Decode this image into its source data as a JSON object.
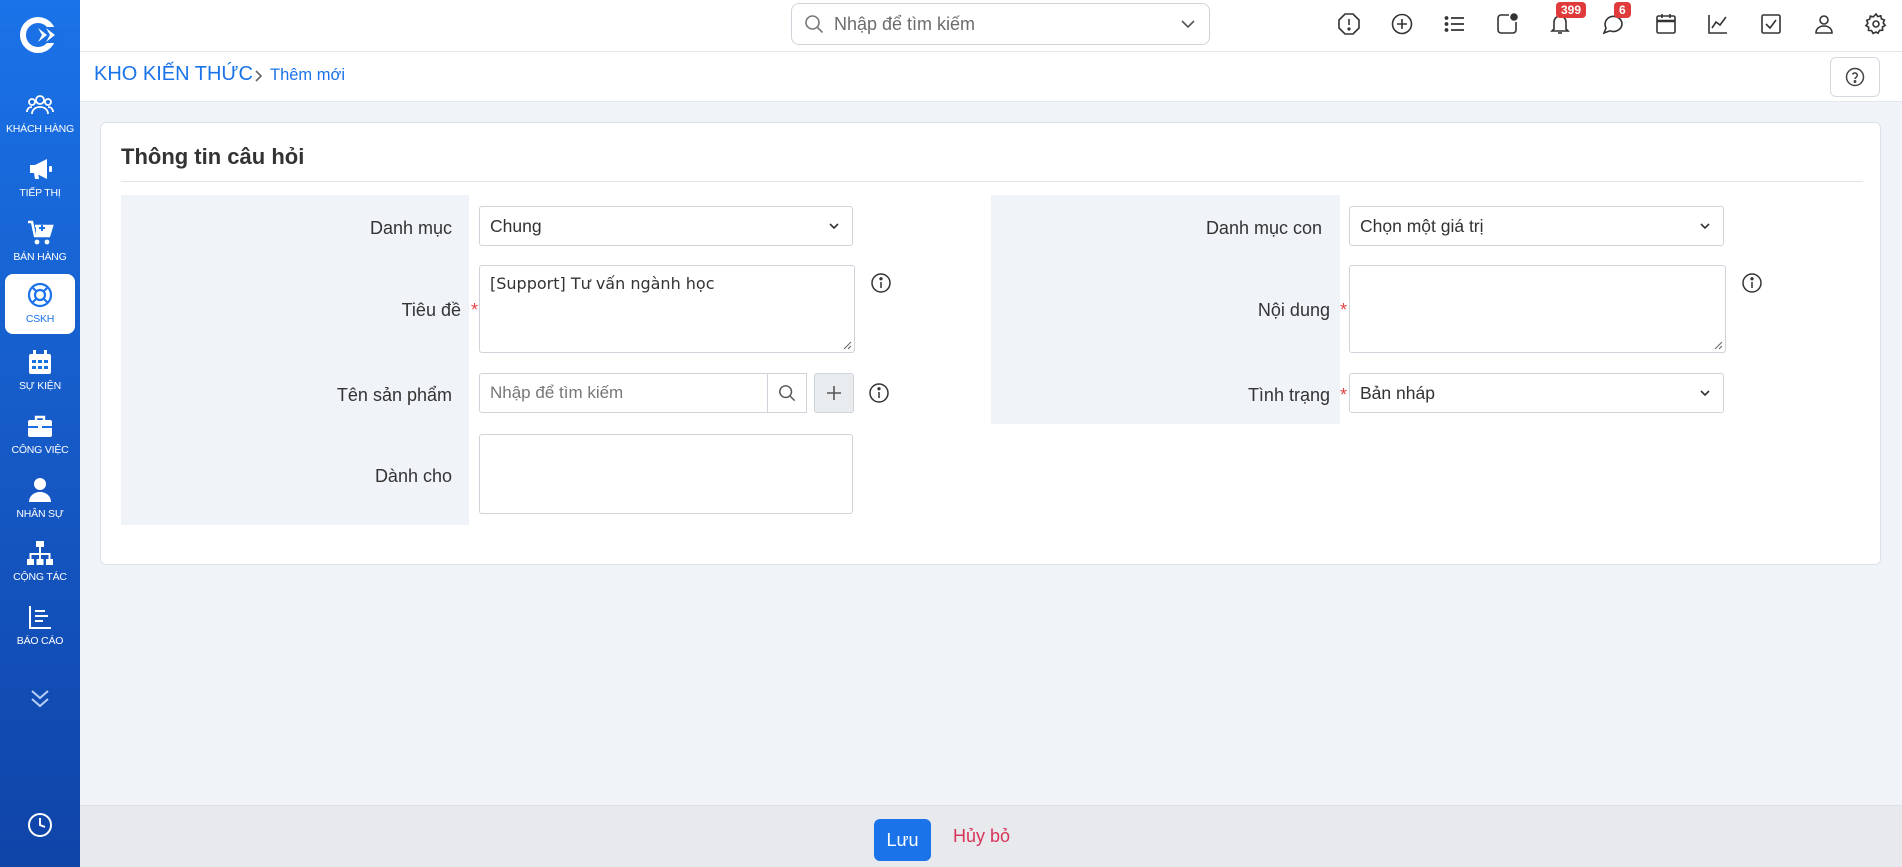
{
  "sidebar": {
    "items": [
      {
        "label": "KHÁCH HÀNG",
        "icon": "users-icon"
      },
      {
        "label": "TIẾP THỊ",
        "icon": "megaphone-icon"
      },
      {
        "label": "BÁN HÀNG",
        "icon": "cart-icon"
      },
      {
        "label": "CSKH",
        "icon": "lifebuoy-icon",
        "active": true
      },
      {
        "label": "SỰ KIỆN",
        "icon": "calendar-icon"
      },
      {
        "label": "CÔNG VIỆC",
        "icon": "briefcase-icon"
      },
      {
        "label": "NHÂN SỰ",
        "icon": "person-icon"
      },
      {
        "label": "CỘNG TÁC",
        "icon": "org-chart-icon"
      },
      {
        "label": "BÁO CÁO",
        "icon": "report-icon"
      }
    ]
  },
  "topbar": {
    "search_placeholder": "Nhập để tìm kiếm",
    "notifications_count": "399",
    "messages_count": "6"
  },
  "breadcrumb": {
    "root": "KHO KIẾN THỨC",
    "current": "Thêm mới"
  },
  "form": {
    "title": "Thông tin câu hỏi",
    "category_label": "Danh mục",
    "category_value": "Chung",
    "title_label": "Tiêu đề",
    "title_value": "[Support] Tư vấn ngành học",
    "product_label": "Tên sản phẩm",
    "product_placeholder": "Nhập để tìm kiếm",
    "audience_label": "Dành cho",
    "subcategory_label": "Danh mục con",
    "subcategory_value": "Chọn một giá trị",
    "content_label": "Nội dung",
    "status_label": "Tình trạng",
    "status_value": "Bản nháp",
    "required_mark": "*"
  },
  "footer": {
    "save_label": "Lưu",
    "cancel_label": "Hủy bỏ"
  },
  "colors": {
    "accent": "#1a73e8",
    "cancel": "#d9345a",
    "badge": "#e03a3a"
  }
}
